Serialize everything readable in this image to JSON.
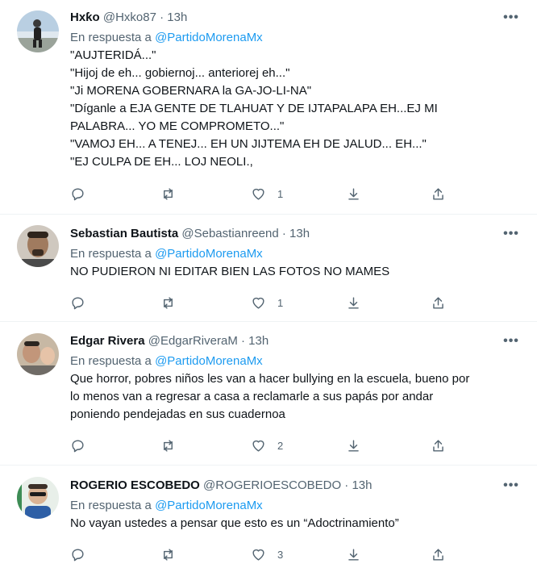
{
  "tweets": [
    {
      "name": "Hxƙo",
      "handle": "@Hxko87",
      "separator": "·",
      "time": "13h",
      "reply_prefix": "En respuesta a",
      "reply_to": "@PartidoMorenaMx",
      "lines": [
        "\"AUJTERIDÁ...\"",
        "\"Hijoj de eh... gobiernoj... anteriorej eh...\"",
        "\"Ji MORENA GOBERNARA la GA-JO-LI-NA\"",
        "\"Díganle a EJA GENTE DE TLAHUAT Y DE IJTAPALAPA EH...EJ MI",
        "PALABRA... YO ME COMPROMETO...\"",
        "\"VAMOJ EH... A TENEJ... EH UN JIJTEMA EH DE JALUD... EH...\"",
        "\"EJ CULPA DE EH... LOJ NEOLI.,"
      ],
      "likes": "1",
      "avatar_colors": [
        "#8fb0d0",
        "#e7eef3"
      ]
    },
    {
      "name": "Sebastian Bautista",
      "handle": "@Sebastianreend",
      "separator": "·",
      "time": "13h",
      "reply_prefix": "En respuesta a",
      "reply_to": "@PartidoMorenaMx",
      "lines": [
        "NO PUDIERON NI EDITAR BIEN LAS FOTOS NO MAMES"
      ],
      "likes": "1",
      "avatar_colors": [
        "#c9c2b8",
        "#5b4a3d"
      ]
    },
    {
      "name": "Edgar Rivera",
      "handle": "@EdgarRiveraM",
      "separator": "·",
      "time": "13h",
      "reply_prefix": "En respuesta a",
      "reply_to": "@PartidoMorenaMx",
      "lines": [
        "Que horror, pobres niños les van a hacer bullying en la escuela, bueno por",
        "lo menos van a regresar a casa a reclamarle a sus papás por andar",
        "poniendo pendejadas en sus cuadernoa"
      ],
      "likes": "2",
      "avatar_colors": [
        "#c8b49c",
        "#2f2a28"
      ]
    },
    {
      "name": "ROGERIO ESCOBEDO",
      "handle": "@ROGERIOESCOBEDO",
      "separator": "·",
      "time": "13h",
      "reply_prefix": "En respuesta a",
      "reply_to": "@PartidoMorenaMx",
      "lines": [
        "No vayan ustedes a pensar que esto es un “Adoctrinamiento”"
      ],
      "likes": "3",
      "avatar_colors": [
        "#3d8c55",
        "#e9d7c2"
      ]
    }
  ],
  "more_label": "•••",
  "colors": {
    "link": "#1d9bf0",
    "secondary": "#536471",
    "border": "#eff3f4"
  }
}
